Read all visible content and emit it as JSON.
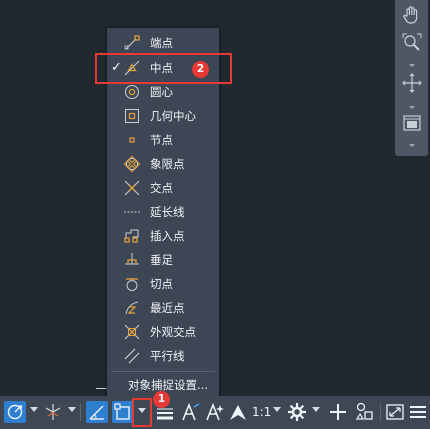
{
  "snap_menu": {
    "items": [
      {
        "label": "端点",
        "icon": "endpoint-snap-icon",
        "checked": false
      },
      {
        "label": "中点",
        "icon": "midpoint-snap-icon",
        "checked": true
      },
      {
        "label": "圆心",
        "icon": "center-snap-icon",
        "checked": false
      },
      {
        "label": "几何中心",
        "icon": "geometric-center-snap-icon",
        "checked": false
      },
      {
        "label": "节点",
        "icon": "node-snap-icon",
        "checked": false
      },
      {
        "label": "象限点",
        "icon": "quadrant-snap-icon",
        "checked": false
      },
      {
        "label": "交点",
        "icon": "intersection-snap-icon",
        "checked": false
      },
      {
        "label": "延长线",
        "icon": "extension-snap-icon",
        "checked": false
      },
      {
        "label": "插入点",
        "icon": "insertion-snap-icon",
        "checked": false
      },
      {
        "label": "垂足",
        "icon": "perpendicular-snap-icon",
        "checked": false
      },
      {
        "label": "切点",
        "icon": "tangent-snap-icon",
        "checked": false
      },
      {
        "label": "最近点",
        "icon": "nearest-snap-icon",
        "checked": false
      },
      {
        "label": "外观交点",
        "icon": "apparent-intersection-snap-icon",
        "checked": false
      },
      {
        "label": "平行线",
        "icon": "parallel-snap-icon",
        "checked": false
      }
    ],
    "settings_label": "对象捕捉设置...",
    "checkmark": "✓"
  },
  "annotations": {
    "badge_1": "1",
    "badge_2": "2",
    "highlight_color": "#e53935"
  },
  "status_bar": {
    "scale_label": "1:1",
    "accent_color": "#2f7fd1"
  }
}
